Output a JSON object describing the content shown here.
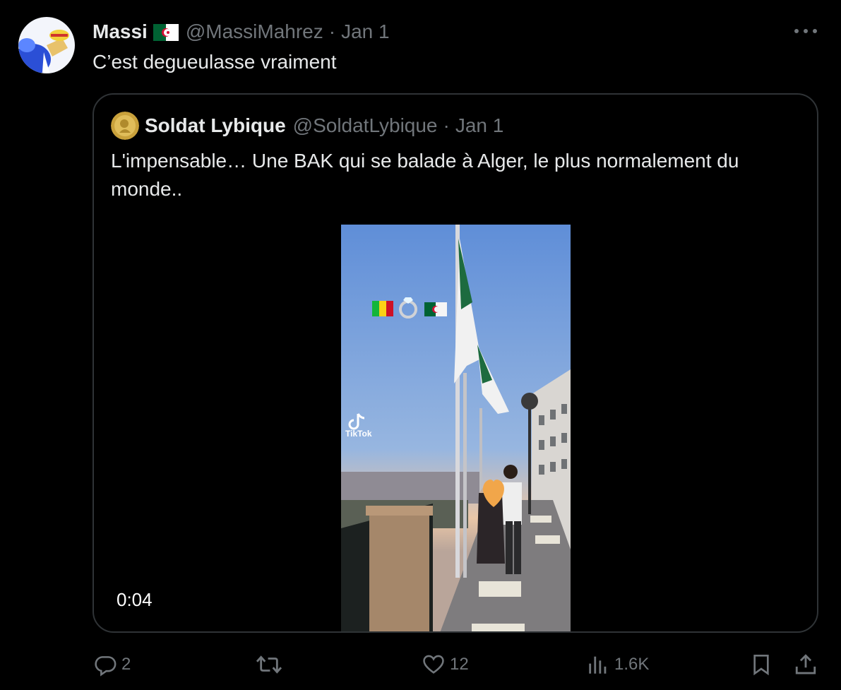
{
  "tweet": {
    "author_name": "Massi",
    "author_handle": "@MassiMahrez",
    "separator": "·",
    "date": "Jan 1",
    "text": "C’est degueulasse vraiment",
    "avatar_icon": "avatar-straw-hat-character",
    "flag_icon": "algeria-flag-icon"
  },
  "quoted": {
    "author_name": "Soldat Lybique",
    "author_handle": "@SoldatLybique",
    "separator": "·",
    "date": "Jan 1",
    "text": "L'impensable… Une BAK qui se balade à Alger, le plus normalement du monde..",
    "media": {
      "type": "video",
      "duration": "0:04",
      "watermark": "TikTok",
      "overlay_icons": [
        "mali-flag-icon",
        "ring-icon",
        "algeria-flag-icon"
      ],
      "heart_sticker_icon": "orange-heart-icon"
    }
  },
  "actions": {
    "reply_count": "2",
    "retweet_count": "",
    "like_count": "12",
    "views_count": "1.6K"
  },
  "colors": {
    "background": "#000000",
    "text": "#e7e9ea",
    "muted": "#71767b",
    "border": "#2f3336"
  }
}
